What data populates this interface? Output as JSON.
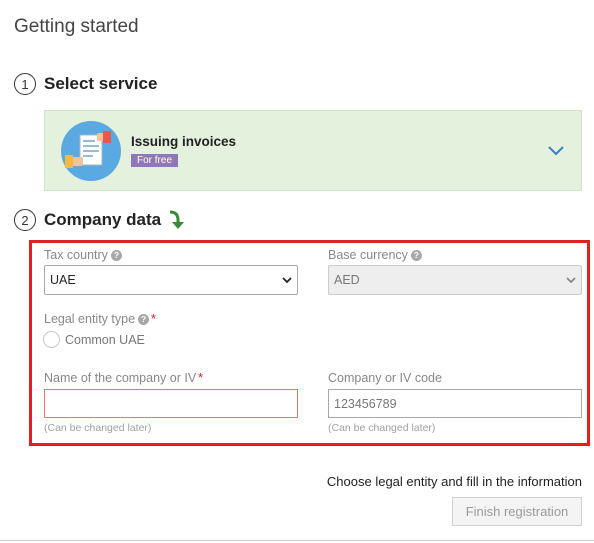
{
  "page": {
    "title": "Getting started"
  },
  "steps": [
    {
      "number": "1",
      "title": "Select service"
    },
    {
      "number": "2",
      "title": "Company data"
    }
  ],
  "service": {
    "name": "Issuing invoices",
    "badge": "For free",
    "icon": "invoice-illustration",
    "accent": "#9078b8"
  },
  "form": {
    "tax_country": {
      "label": "Tax country",
      "value": "UAE"
    },
    "base_currency": {
      "label": "Base currency",
      "value": "AED"
    },
    "legal_entity": {
      "label": "Legal entity type",
      "option": "Common UAE"
    },
    "company_name": {
      "label": "Name of the company or IV",
      "value": "",
      "hint": "(Can be changed later)"
    },
    "company_code": {
      "label": "Company or IV code",
      "placeholder": "123456789",
      "hint": "(Can be changed later)"
    }
  },
  "footer": {
    "note": "Choose legal entity and fill in the information",
    "finish_label": "Finish registration"
  },
  "colors": {
    "highlight_border": "#e02020",
    "card_bg": "#e3f1dd",
    "required": "#cc2222"
  }
}
